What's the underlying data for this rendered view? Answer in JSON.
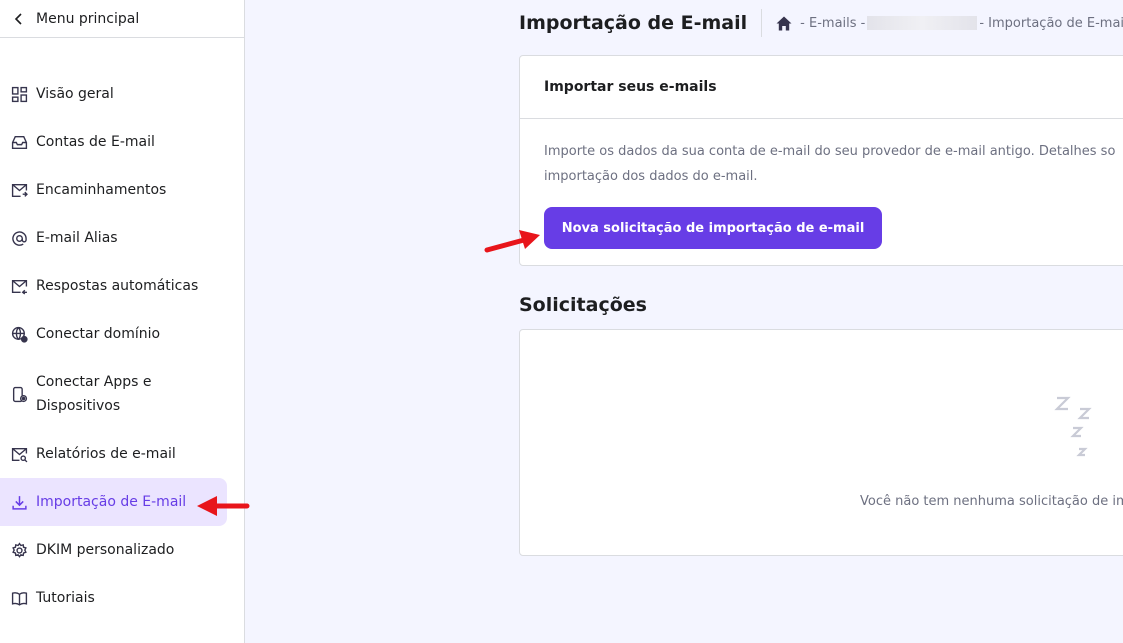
{
  "sidebar": {
    "back_label": "Menu principal",
    "items": [
      {
        "label": "Visão geral",
        "icon": "grid-icon"
      },
      {
        "label": "Contas de E-mail",
        "icon": "inbox-icon"
      },
      {
        "label": "Encaminhamentos",
        "icon": "mail-forward-icon"
      },
      {
        "label": "E-mail Alias",
        "icon": "at-icon"
      },
      {
        "label": "Respostas automáticas",
        "icon": "mail-reply-icon"
      },
      {
        "label": "Conectar domínio",
        "icon": "globe-gear-icon"
      },
      {
        "label": "Conectar Apps e Dispositivos",
        "icon": "device-gear-icon"
      },
      {
        "label": "Relatórios de e-mail",
        "icon": "mail-search-icon"
      },
      {
        "label": "Importação de E-mail",
        "icon": "download-icon",
        "active": true
      },
      {
        "label": "DKIM personalizado",
        "icon": "gear-icon"
      },
      {
        "label": "Tutoriais",
        "icon": "book-icon"
      }
    ]
  },
  "header": {
    "title": "Importação de E-mail",
    "breadcrumb": {
      "separator_1": "- E-mails -",
      "separator_2": "- Importação de E-mail"
    }
  },
  "import_card": {
    "title": "Importar seus e-mails",
    "description_line1": "Importe os dados da sua conta de e-mail do seu provedor de e-mail antigo. Detalhes so",
    "description_line2": "importação dos dados do e-mail.",
    "button_label": "Nova solicitação de importação de e-mail"
  },
  "requests": {
    "title": "Solicitações",
    "empty_text": "Você não tem nenhuma solicitação de im"
  },
  "colors": {
    "accent": "#673de6",
    "active_bg": "#ebe4ff",
    "page_bg": "#f4f5ff",
    "annotation_arrow": "#e8151b"
  }
}
